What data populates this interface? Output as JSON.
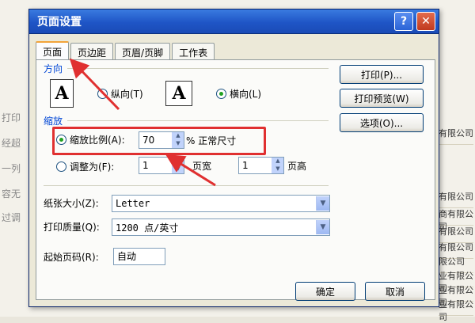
{
  "background": {
    "left_text": [
      "打印",
      "经超",
      "一列",
      "容无",
      "过调"
    ],
    "right_cells": [
      "有限公司",
      "有限公司",
      "商有限公司",
      "有限公司",
      "有限公司",
      "限公司",
      "业有限公司",
      "业有限公司",
      "业有限公司",
      "业有限公司"
    ]
  },
  "dialog": {
    "title": "页面设置",
    "help_button": "?",
    "close_button": "✕",
    "tabs": [
      "页面",
      "页边距",
      "页眉/页脚",
      "工作表"
    ],
    "active_tab": "页面",
    "orientation": {
      "label": "方向",
      "portrait_label": "纵向(T)",
      "landscape_label": "横向(L)",
      "selected": "横向(L)",
      "portrait_glyph": "A",
      "landscape_glyph": "A"
    },
    "scaling": {
      "label": "缩放",
      "adjust_label": "缩放比例(A):",
      "adjust_value": "70",
      "adjust_suffix": "% 正常尺寸",
      "fit_label": "调整为(F):",
      "fit_wide_value": "1",
      "fit_wide_suffix": "页宽",
      "fit_tall_value": "1",
      "fit_tall_suffix": "页高",
      "selected": "缩放比例(A):"
    },
    "paper_size": {
      "label": "纸张大小(Z):",
      "value": "Letter"
    },
    "print_quality": {
      "label": "打印质量(Q):",
      "value": "1200 点/英寸"
    },
    "first_page": {
      "label": "起始页码(R):",
      "value": "自动"
    },
    "side_buttons": [
      "打印(P)...",
      "打印预览(W)",
      "选项(O)..."
    ],
    "ok_button": "确定",
    "cancel_button": "取消"
  },
  "colors": {
    "title_bar": "#1f55c6",
    "group_label": "#0046d5",
    "annotation": "#e03030",
    "radio_selected": "#21a121"
  }
}
